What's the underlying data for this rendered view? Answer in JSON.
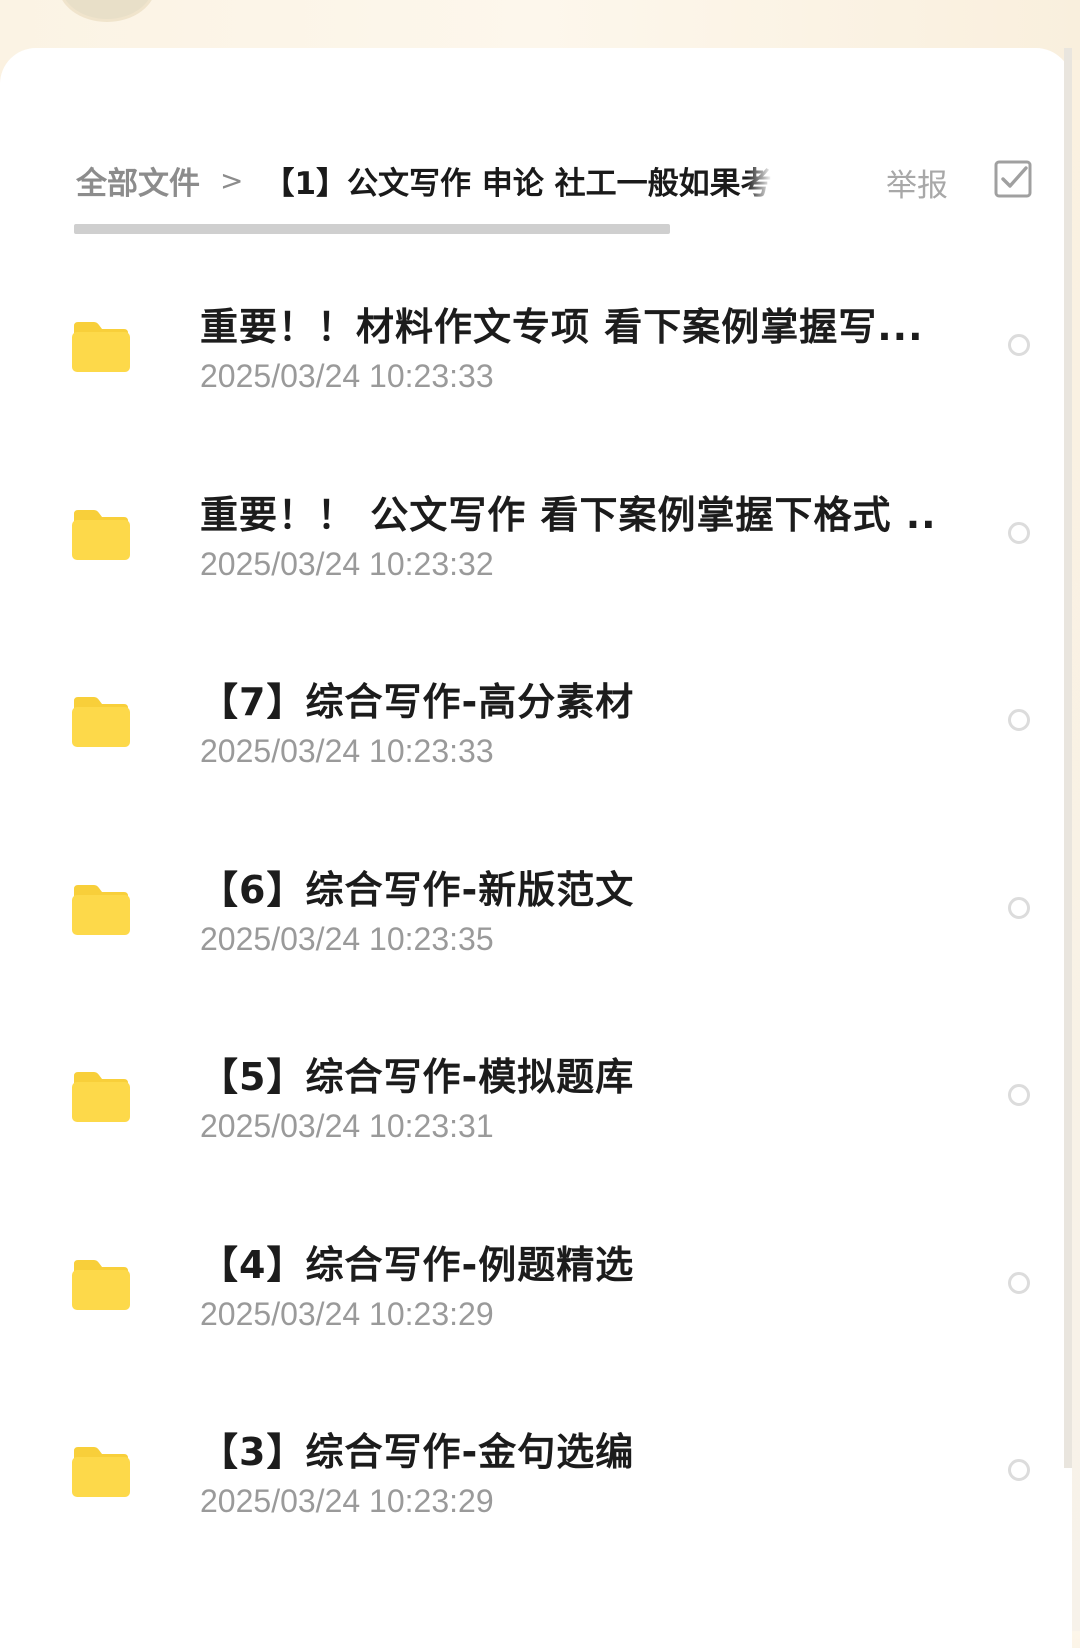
{
  "breadcrumb": {
    "root": "全部文件",
    "separator": ">",
    "current": "【1】公文写作 申论 社工一般如果考"
  },
  "header": {
    "report_label": "举报"
  },
  "colors": {
    "folder": "#fdd94a",
    "folder_tab": "#f8cf3a",
    "title": "#1c1c1c",
    "date": "#9a9a9a"
  },
  "icons": {
    "folder": "folder-icon",
    "select": "checkbox-icon",
    "radio": "radio-circle-icon"
  },
  "files": [
    {
      "name": "重要！！材料作文专项 看下案例掌握写...",
      "date": "2025/03/24 10:23:33"
    },
    {
      "name": "重要！！ 公文写作 看下案例掌握下格式 ...",
      "date": "2025/03/24 10:23:32"
    },
    {
      "name": "【7】综合写作-高分素材",
      "date": "2025/03/24 10:23:33"
    },
    {
      "name": "【6】综合写作-新版范文",
      "date": "2025/03/24 10:23:35"
    },
    {
      "name": "【5】综合写作-模拟题库",
      "date": "2025/03/24 10:23:31"
    },
    {
      "name": "【4】综合写作-例题精选",
      "date": "2025/03/24 10:23:29"
    },
    {
      "name": "【3】综合写作-金句选编",
      "date": "2025/03/24 10:23:29"
    }
  ]
}
